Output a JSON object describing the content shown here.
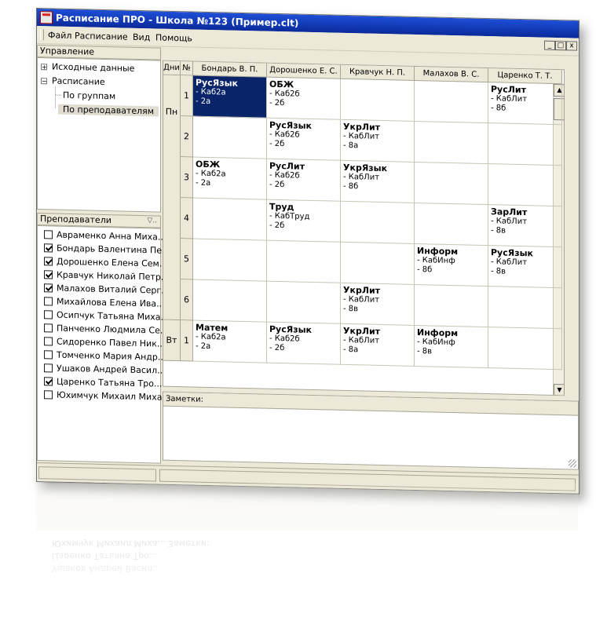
{
  "window": {
    "title": "Расписание ПРО - Школа №123 (Пример.clt)"
  },
  "menu": [
    "Файл",
    "Расписание",
    "Вид",
    "Помощь"
  ],
  "mdi_buttons": [
    "_",
    "□",
    "x"
  ],
  "control_panel": {
    "title": "Управление",
    "tree": [
      {
        "label": "Исходные данные",
        "toggle": "+"
      },
      {
        "label": "Расписание",
        "toggle": "−"
      },
      {
        "label": "По группам"
      },
      {
        "label": "По преподавателям"
      }
    ]
  },
  "teachers_panel": {
    "title": "Преподаватели",
    "filter_icon": "funnel-icon",
    "items": [
      {
        "name": "Авраменко Анна Миха...",
        "checked": false
      },
      {
        "name": "Бондарь Валентина Пе...",
        "checked": true
      },
      {
        "name": "Дорошенко Елена Сем...",
        "checked": true
      },
      {
        "name": "Кравчук Николай Петр...",
        "checked": true
      },
      {
        "name": "Малахов Виталий Серг...",
        "checked": true
      },
      {
        "name": "Михайлова Елена Ива...",
        "checked": false
      },
      {
        "name": "Осипчук Татьяна Миха...",
        "checked": false
      },
      {
        "name": "Панченко Людмила Се...",
        "checked": false
      },
      {
        "name": "Сидоренко Павел Ник...",
        "checked": false
      },
      {
        "name": "Томченко Мария Андр...",
        "checked": false
      },
      {
        "name": "Ушаков Андрей Васил...",
        "checked": false
      },
      {
        "name": "Царенко Татьяна Тро...",
        "checked": true
      },
      {
        "name": "Юхимчук Михаил Миха...",
        "checked": false
      }
    ]
  },
  "schedule": {
    "headers": {
      "day": "Дни",
      "num": "№"
    },
    "teachers": [
      "Бондарь В. П.",
      "Дорошенко Е. С.",
      "Кравчук Н. П.",
      "Малахов В. С.",
      "Царенко Т. Т."
    ],
    "days": [
      "Пн",
      "Вт"
    ],
    "rows": [
      {
        "num": "1",
        "cells": [
          {
            "subject": "РусЯзык",
            "room": "- Каб2а",
            "group": "- 2а",
            "selected": true
          },
          {
            "subject": "ОБЖ",
            "room": "- Каб2б",
            "group": "- 2б"
          },
          {},
          {},
          {
            "subject": "РусЛит",
            "room": "- КабЛит",
            "group": "- 8б"
          }
        ]
      },
      {
        "num": "2",
        "cells": [
          {},
          {
            "subject": "РусЯзык",
            "room": "- Каб2б",
            "group": "- 2б"
          },
          {
            "subject": "УкрЛит",
            "room": "- КабЛит",
            "group": "- 8а"
          },
          {},
          {}
        ]
      },
      {
        "num": "3",
        "cells": [
          {
            "subject": "ОБЖ",
            "room": "- Каб2а",
            "group": "- 2а"
          },
          {
            "subject": "РусЛит",
            "room": "- Каб2б",
            "group": "- 2б"
          },
          {
            "subject": "УкрЯзык",
            "room": "- КабЛит",
            "group": "- 8б"
          },
          {},
          {}
        ]
      },
      {
        "num": "4",
        "cells": [
          {},
          {
            "subject": "Труд",
            "room": "- КабТруд",
            "group": "- 2б"
          },
          {},
          {},
          {
            "subject": "ЗарЛит",
            "room": "- КабЛит",
            "group": "- 8в"
          }
        ]
      },
      {
        "num": "5",
        "cells": [
          {},
          {},
          {},
          {
            "subject": "Информ",
            "room": "- КабИнф",
            "group": "- 8б"
          },
          {
            "subject": "РусЯзык",
            "room": "- КабЛит",
            "group": "- 8в"
          }
        ]
      },
      {
        "num": "6",
        "cells": [
          {},
          {},
          {
            "subject": "УкрЛит",
            "room": "- КабЛит",
            "group": "- 8в"
          },
          {},
          {}
        ]
      },
      {
        "num": "1",
        "cells": [
          {
            "subject": "Матем",
            "room": "- Каб2а",
            "group": "- 2а"
          },
          {
            "subject": "РусЯзык",
            "room": "- Каб2б",
            "group": "- 2б"
          },
          {
            "subject": "УкрЛит",
            "room": "- КабЛит",
            "group": "- 8а"
          },
          {
            "subject": "Информ",
            "room": "- КабИнф",
            "group": "- 8в"
          },
          {}
        ]
      }
    ]
  },
  "notes": {
    "label": "Заметки:"
  }
}
